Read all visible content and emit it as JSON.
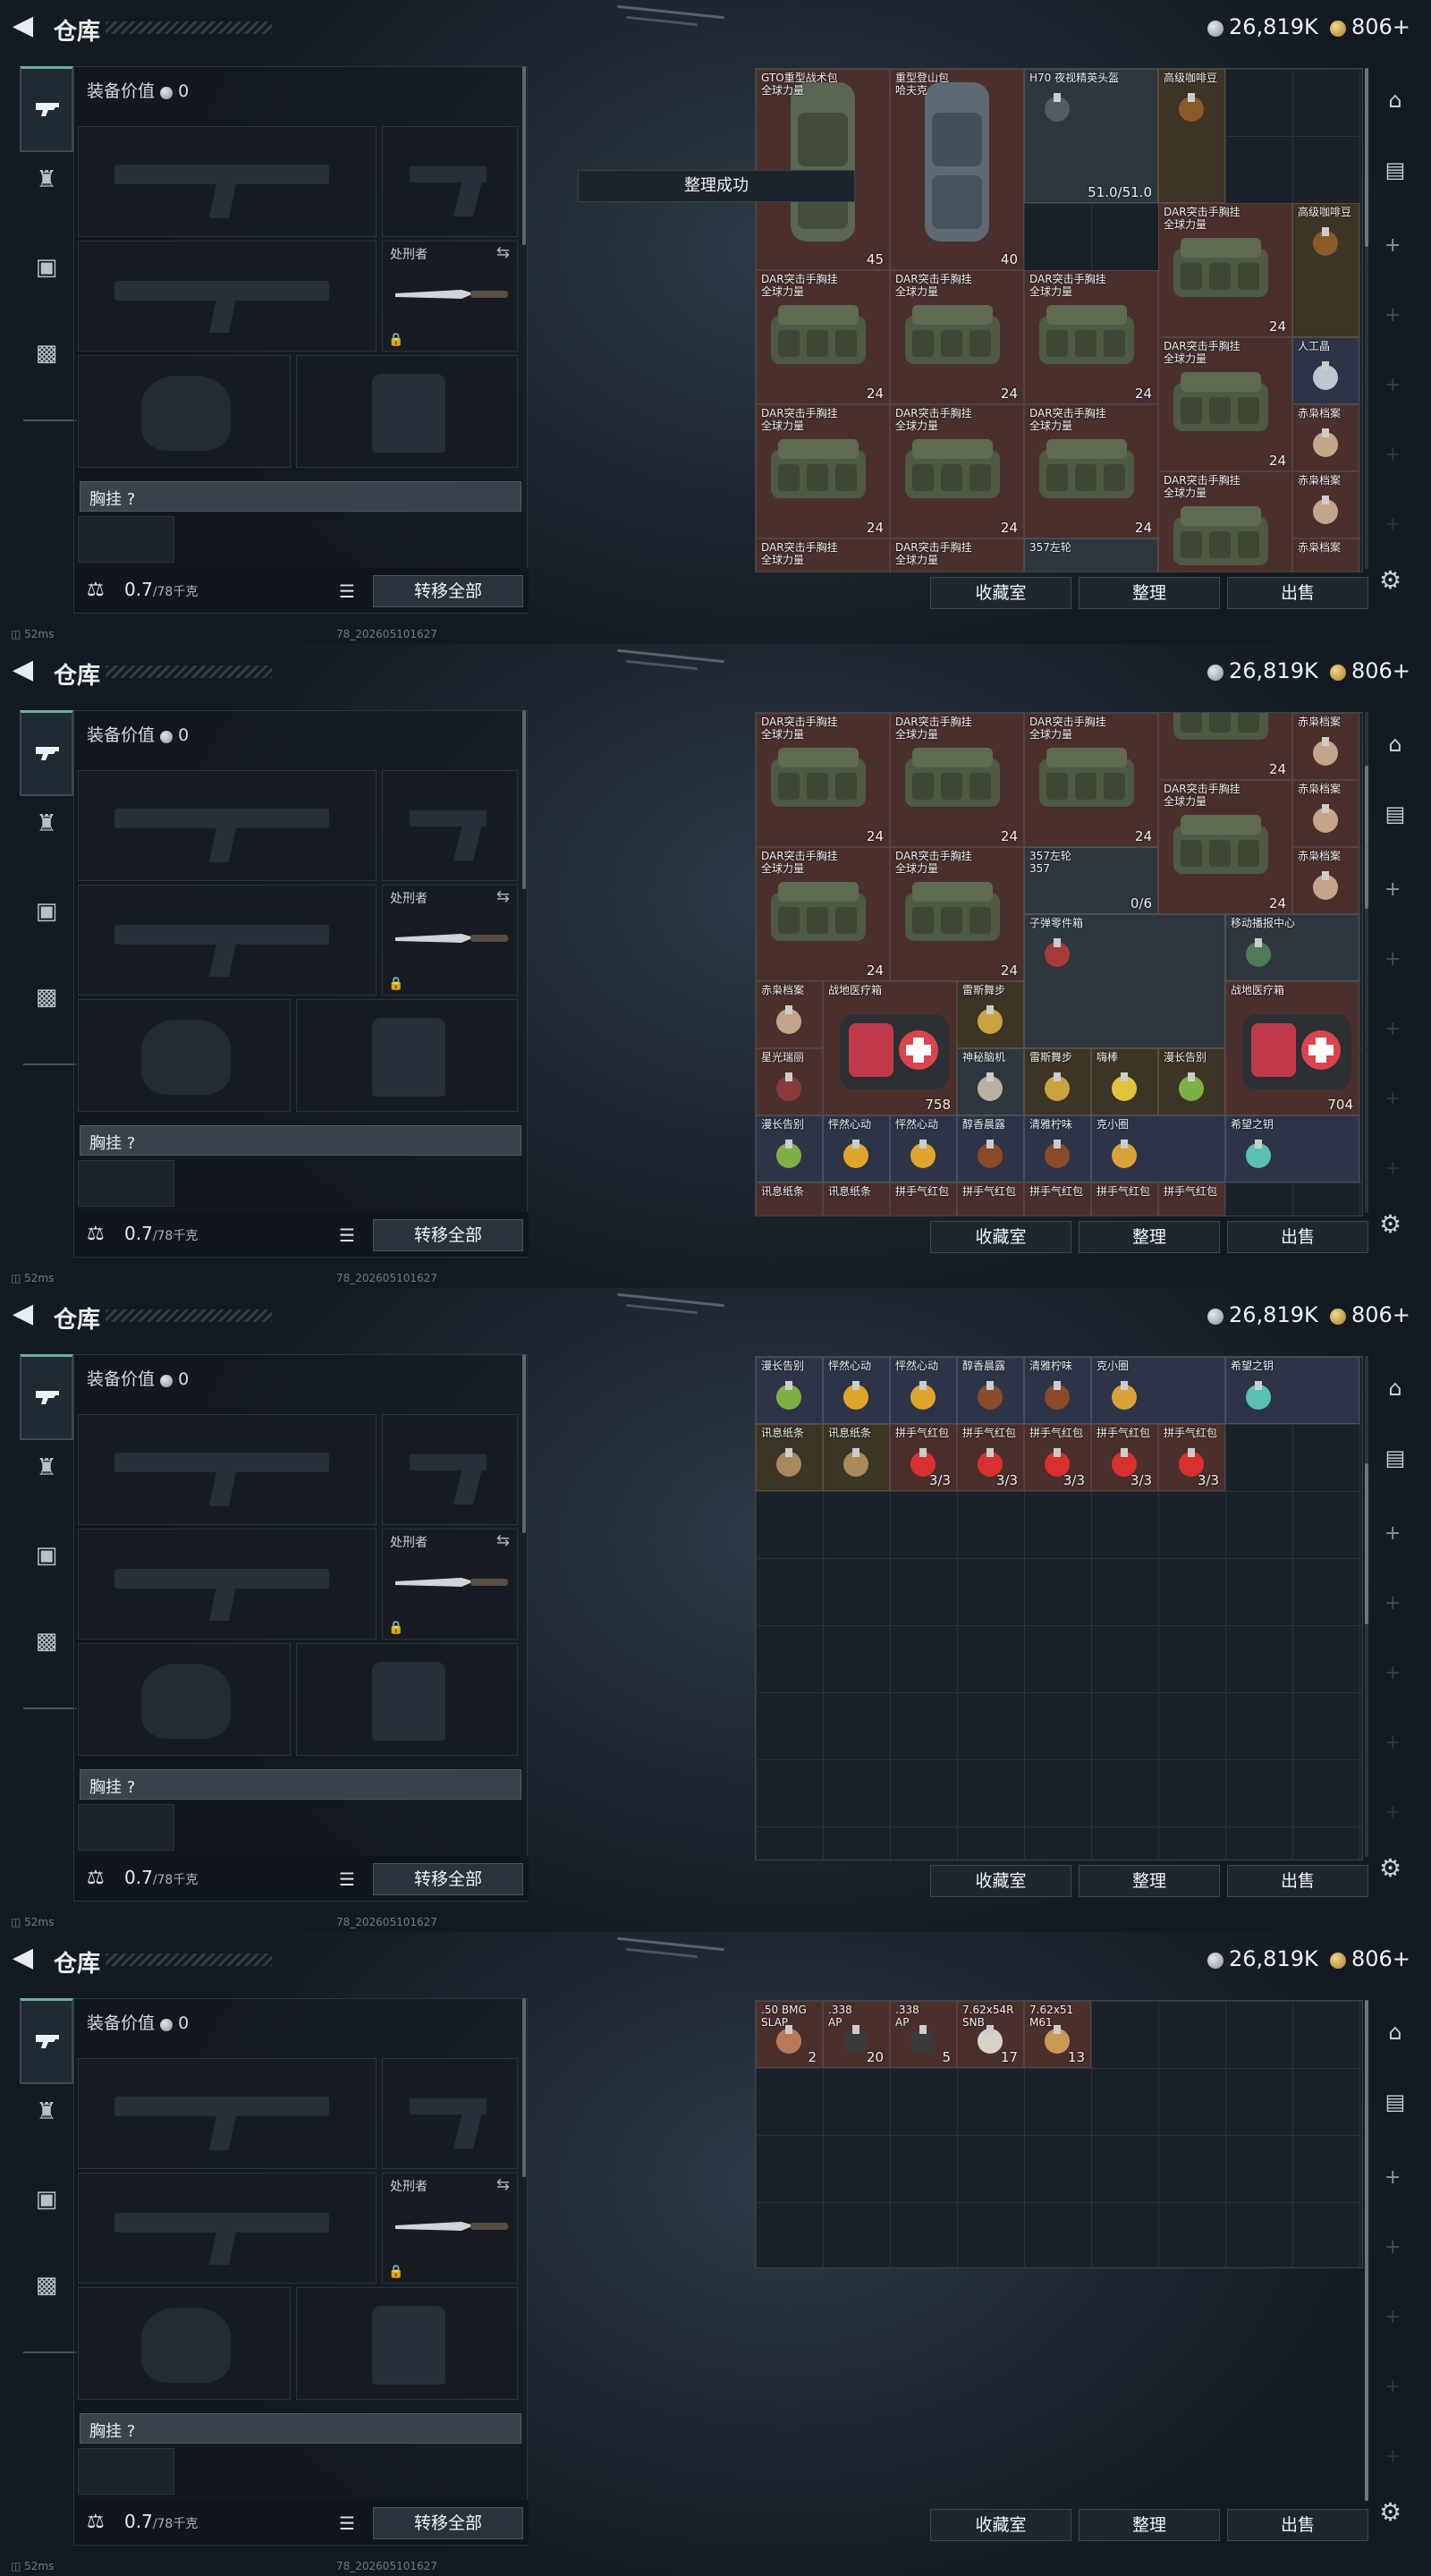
{
  "topbar": {
    "title": "仓库",
    "silver": "26,819K",
    "gold": "806+"
  },
  "equip": {
    "value_label": "装备价值",
    "value": "0",
    "knife_label": "处刑者",
    "vest_label": "胸挂 ?",
    "weight": "0.7",
    "weight_max": "/78千克",
    "transfer_label": "转移全部"
  },
  "toast": "整理成功",
  "buttons": {
    "collection": "收藏室",
    "organize": "整理",
    "sell": "出售"
  },
  "status": {
    "ping": "52ms",
    "build": "78_202605101627"
  },
  "panels": [
    {
      "items": [
        {
          "name": "GTO重型战术包\n全球力量",
          "qty": "45"
        },
        {
          "name": "重型登山包\n哈夫克",
          "qty": "40"
        },
        {
          "name": "H70 夜视精英头盔",
          "qty": "51.0/51.0"
        },
        {
          "name": "高级咖啡豆",
          "qty": ""
        },
        {
          "name": "DAR突击手胸挂\n全球力量",
          "qty": "24"
        },
        {
          "name": "高级咖啡豆",
          "qty": ""
        },
        {
          "name": "人工晶",
          "qty": ""
        },
        {
          "name": "赤枭档案",
          "qty": ""
        },
        {
          "name": "赤枭档案",
          "qty": ""
        },
        {
          "name": "赤枭档案",
          "qty": ""
        },
        {
          "name": "357左轮",
          "qty": ""
        }
      ]
    },
    {
      "items": [
        {
          "name": "DAR突击手胸挂\n全球力量",
          "qty": "24"
        },
        {
          "name": "赤枭档案",
          "qty": ""
        },
        {
          "name": "357左轮\n357",
          "qty": "0/6"
        },
        {
          "name": "子弹零件箱",
          "qty": ""
        },
        {
          "name": "移动播报中心",
          "qty": ""
        },
        {
          "name": "战地医疗箱",
          "qty": "758"
        },
        {
          "name": "战地医疗箱",
          "qty": "704"
        },
        {
          "name": "雷斯舞步",
          "qty": ""
        },
        {
          "name": "星光瑞丽",
          "qty": ""
        },
        {
          "name": "神秘脑机",
          "qty": ""
        },
        {
          "name": "嗨棒",
          "qty": ""
        },
        {
          "name": "漫长告别",
          "qty": ""
        },
        {
          "name": "漫长告别",
          "qty": ""
        },
        {
          "name": "怦然心动",
          "qty": ""
        },
        {
          "name": "醇香晨露",
          "qty": ""
        },
        {
          "name": "清雅柠味",
          "qty": ""
        },
        {
          "name": "克小圈",
          "qty": ""
        },
        {
          "name": "希望之钥",
          "qty": ""
        },
        {
          "name": "讯息纸条",
          "qty": ""
        },
        {
          "name": "拼手气红包",
          "qty": ""
        }
      ]
    },
    {
      "items": [
        {
          "name": "漫长告别",
          "qty": ""
        },
        {
          "name": "怦然心动",
          "qty": ""
        },
        {
          "name": "醇香晨露",
          "qty": ""
        },
        {
          "name": "清雅柠味",
          "qty": ""
        },
        {
          "name": "克小圈",
          "qty": ""
        },
        {
          "name": "希望之钥",
          "qty": ""
        },
        {
          "name": "讯息纸条",
          "qty": ""
        },
        {
          "name": "拼手气红包",
          "qty": "3/3"
        }
      ]
    },
    {
      "items": [
        {
          "name": ".50 BMG\nSLAP",
          "qty": "2"
        },
        {
          "name": ".338\nAP",
          "qty": "20"
        },
        {
          "name": ".338\nAP",
          "qty": "5"
        },
        {
          "name": "7.62x54R\nSNB",
          "qty": "17"
        },
        {
          "name": "7.62x51\nM61",
          "qty": "13"
        }
      ]
    }
  ],
  "icons": {
    "back": "back-arrow-icon",
    "gun": "gun-icon",
    "bag": "bag-icon",
    "case": "case-icon",
    "gear": "gear-icon"
  }
}
